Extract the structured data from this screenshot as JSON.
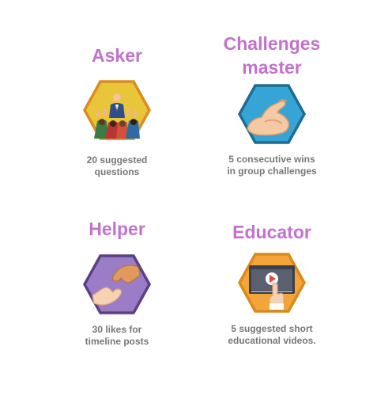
{
  "colors": {
    "title": "#c272cc",
    "description": "#777777",
    "hex_border": "#e08d23"
  },
  "badges": [
    {
      "title": "Asker",
      "icon": "crowd-raising-hands-icon",
      "hex_fill": "#e9c53a",
      "hex_border": "#dc8b22",
      "description": "20 suggested\nquestions"
    },
    {
      "title": "Challenges\nmaster",
      "icon": "flexed-biceps-icon",
      "hex_fill": "#37a4d6",
      "hex_border": "#1d6c92",
      "description": "5 consecutive wins\nin group challenges"
    },
    {
      "title": "Helper",
      "icon": "helping-hands-icon",
      "hex_fill": "#9b7cc7",
      "hex_border": "#5b3f85",
      "description": "30 likes for\ntimeline posts"
    },
    {
      "title": "Educator",
      "icon": "video-player-click-icon",
      "hex_fill": "#f4a53a",
      "hex_border": "#d98a1d",
      "description": "5 suggested short\neducational videos."
    }
  ]
}
